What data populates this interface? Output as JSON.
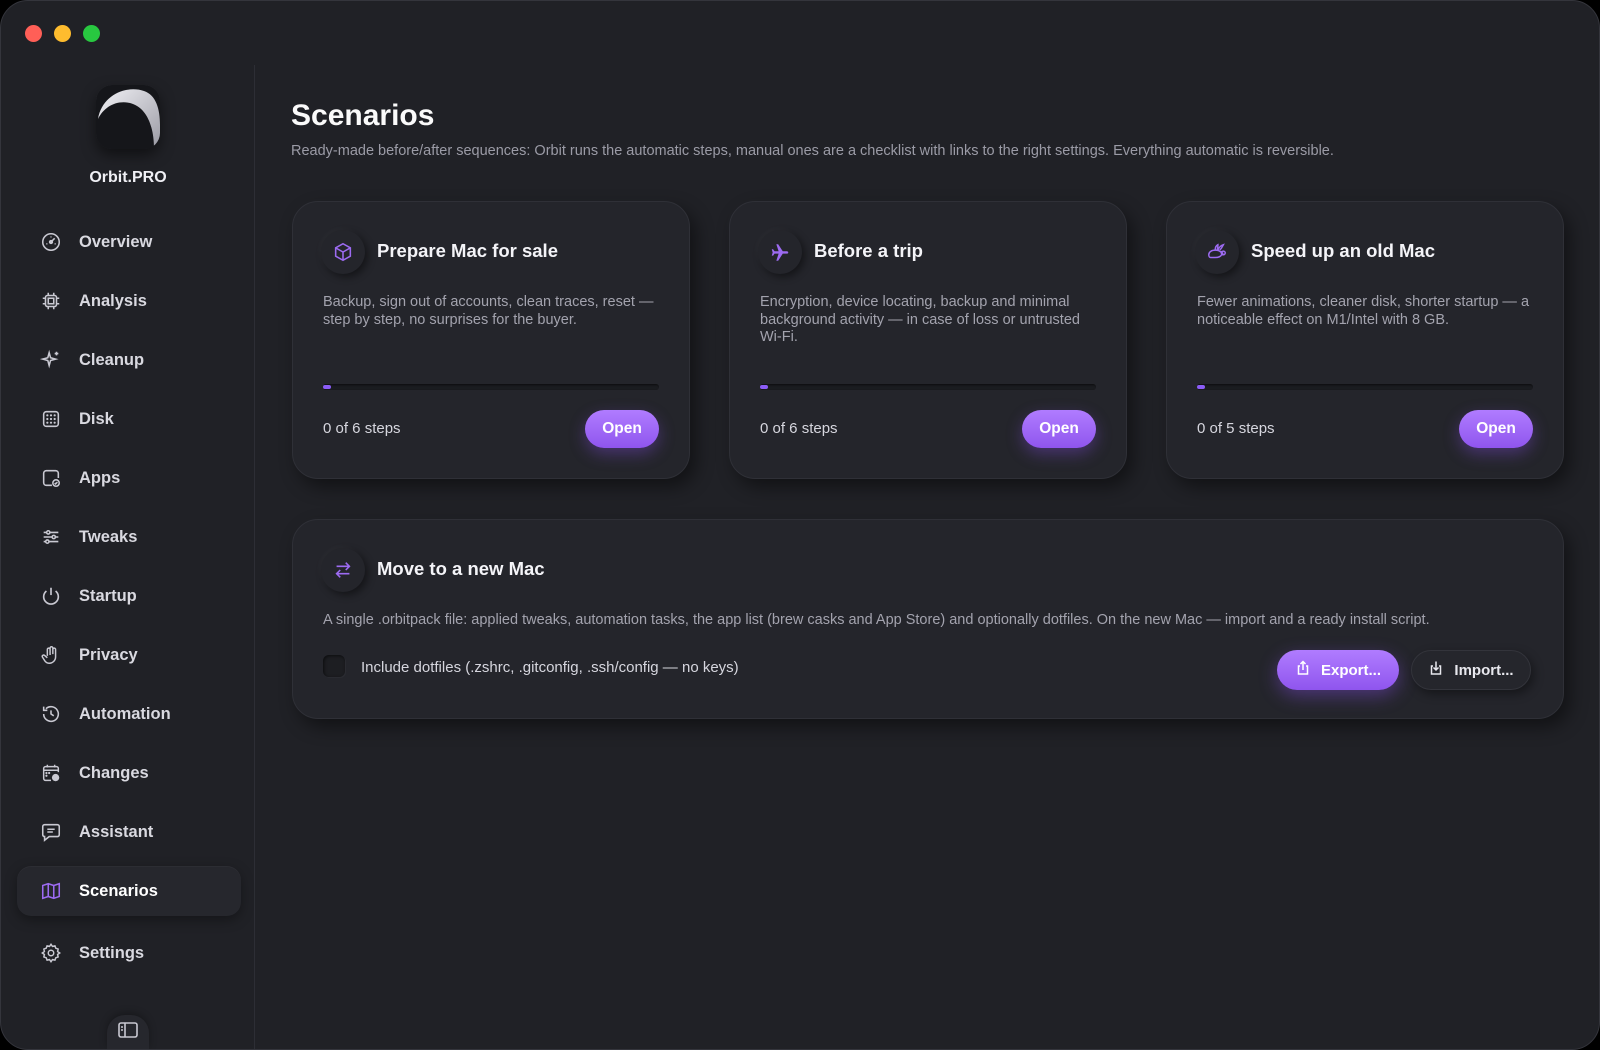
{
  "app": {
    "name": "Orbit.PRO"
  },
  "colors": {
    "accent": "#9d6bf2",
    "background": "#202126",
    "card": "#24252b"
  },
  "sidebar": {
    "items": [
      {
        "label": "Overview",
        "icon": "gauge-icon"
      },
      {
        "label": "Analysis",
        "icon": "chip-icon"
      },
      {
        "label": "Cleanup",
        "icon": "sparkles-icon"
      },
      {
        "label": "Disk",
        "icon": "grid-icon"
      },
      {
        "label": "Apps",
        "icon": "app-check-icon"
      },
      {
        "label": "Tweaks",
        "icon": "sliders-icon"
      },
      {
        "label": "Startup",
        "icon": "power-icon"
      },
      {
        "label": "Privacy",
        "icon": "hand-icon"
      },
      {
        "label": "Automation",
        "icon": "history-icon"
      },
      {
        "label": "Changes",
        "icon": "calendar-clock-icon"
      },
      {
        "label": "Assistant",
        "icon": "chat-icon"
      },
      {
        "label": "Scenarios",
        "icon": "map-icon",
        "active": true
      },
      {
        "label": "Settings",
        "icon": "gear-icon"
      }
    ]
  },
  "main": {
    "title": "Scenarios",
    "subtitle": "Ready-made before/after sequences: Orbit runs the automatic steps, manual ones are a checklist with links to the right settings. Everything automatic is reversible.",
    "scenarios": [
      {
        "title": "Prepare Mac for sale",
        "icon": "package-icon",
        "description": "Backup, sign out of accounts, clean traces, reset — step by step, no surprises for the buyer.",
        "steps": "0 of 6 steps",
        "progress": 0,
        "button": "Open"
      },
      {
        "title": "Before a trip",
        "icon": "airplane-icon",
        "description": "Encryption, device locating, backup and minimal background activity — in case of loss or untrusted Wi-Fi.",
        "steps": "0 of 6 steps",
        "progress": 0,
        "button": "Open"
      },
      {
        "title": "Speed up an old Mac",
        "icon": "rabbit-icon",
        "description": "Fewer animations, cleaner disk, shorter startup — a noticeable effect on M1/Intel with 8 GB.",
        "steps": "0 of 5 steps",
        "progress": 0,
        "button": "Open"
      }
    ],
    "move": {
      "title": "Move to a new Mac",
      "icon": "transfer-arrows-icon",
      "description": "A single .orbitpack file: applied tweaks, automation tasks, the app list (brew casks and App Store) and optionally dotfiles. On the new Mac — import and a ready install script.",
      "checkbox_label": "Include dotfiles (.zshrc, .gitconfig, .ssh/config — no keys)",
      "checkbox_checked": false,
      "export_label": "Export...",
      "import_label": "Import..."
    }
  }
}
